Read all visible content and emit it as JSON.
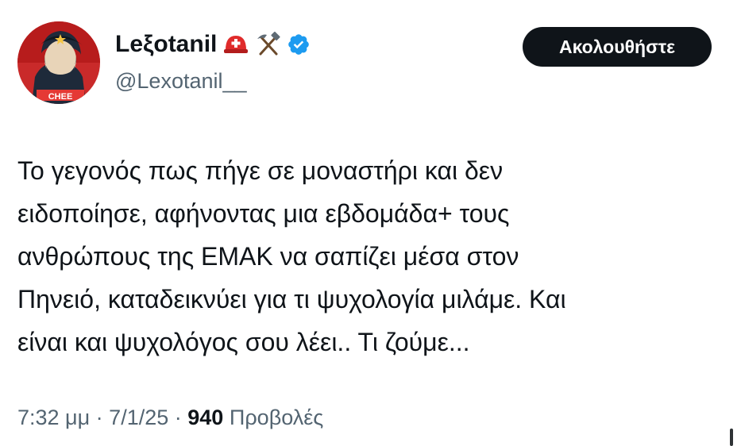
{
  "user": {
    "display_name": "Leξotanil",
    "handle": "@Lexotanil__",
    "avatar_icon": "avatar-portrait-red-icon",
    "badges": [
      "rescue-helmet-icon",
      "hammer-and-pick-icon",
      "verified-badge-icon"
    ],
    "verified_color": "#1d9bf0"
  },
  "follow_button": {
    "label": "Ακολουθήστε"
  },
  "tweet": {
    "lines": [
      "Το γεγονός πως πήγε σε μοναστήρι και δεν",
      "ειδοποίησε, αφήνοντας μια εβδομάδα+ τους",
      "ανθρώπους της ΕΜΑΚ να σαπίζει μέσα στον",
      "Πηνειό, καταδεικνύει για τι ψυχολογία μιλάμε. Και",
      "είναι και ψυχολόγος σου λέει.. Τι ζούμε..."
    ]
  },
  "meta": {
    "time": "7:32 μμ",
    "separator": " · ",
    "date": "7/1/25",
    "views_count": "940",
    "views_label": "Προβολές"
  },
  "colors": {
    "text": "#0f1419",
    "secondary": "#536471",
    "button_bg": "#0f1419"
  }
}
